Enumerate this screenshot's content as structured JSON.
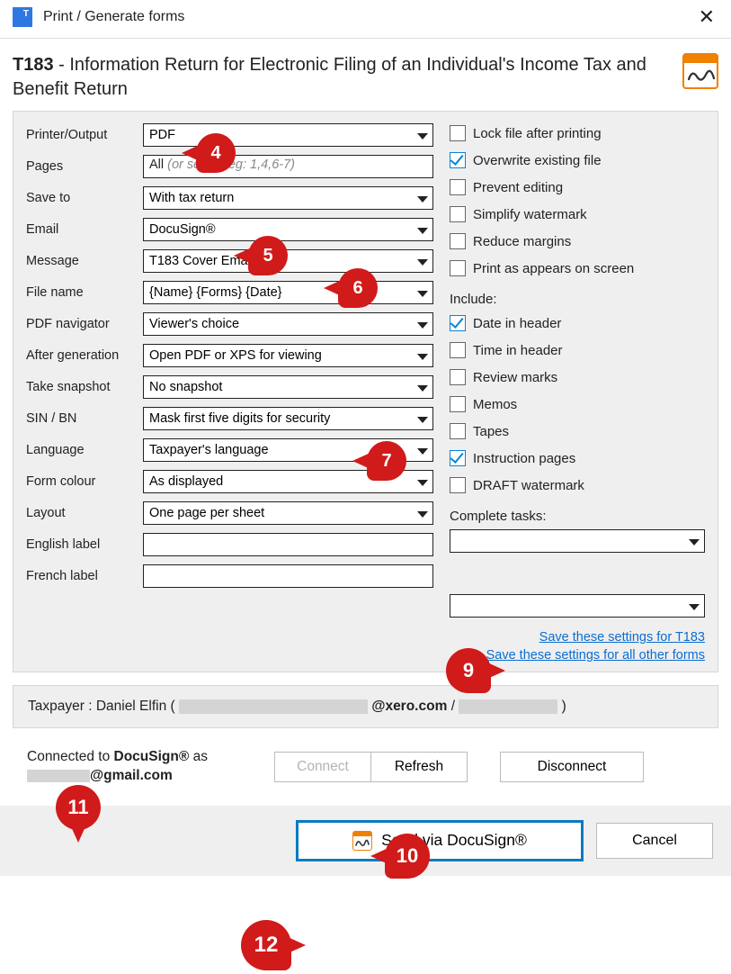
{
  "window": {
    "title": "Print / Generate forms"
  },
  "form": {
    "code": "T183",
    "description": " - Information Return for Electronic Filing of an Individual's Income Tax and Benefit Return"
  },
  "labels": {
    "printer_output": "Printer/Output",
    "pages": "Pages",
    "save_to": "Save to",
    "email": "Email",
    "message": "Message",
    "file_name": "File name",
    "pdf_navigator": "PDF navigator",
    "after_generation": "After generation",
    "take_snapshot": "Take snapshot",
    "sin_bn": "SIN / BN",
    "language": "Language",
    "form_colour": "Form colour",
    "layout": "Layout",
    "english_label": "English label",
    "french_label": "French label",
    "include": "Include:",
    "complete_tasks": "Complete tasks:"
  },
  "values": {
    "printer_output": "PDF",
    "pages_prefix": "All",
    "pages_placeholder": " (or select, eg: 1,4,6-7)",
    "save_to": "With tax return",
    "email": "DocuSign®",
    "message": "T183 Cover Email",
    "file_name": "{Name} {Forms} {Date}",
    "pdf_navigator": "Viewer's choice",
    "after_generation": "Open PDF or XPS for viewing",
    "take_snapshot": "No snapshot",
    "sin_bn": "Mask first five digits for security",
    "language": "Taxpayer's language",
    "form_colour": "As displayed",
    "layout": "One page per sheet",
    "english_label": "",
    "french_label": "",
    "complete_task_1": "",
    "complete_task_2": ""
  },
  "checkboxes_top": [
    {
      "label": "Lock file after printing",
      "checked": false
    },
    {
      "label": "Overwrite existing file",
      "checked": true
    },
    {
      "label": "Prevent editing",
      "checked": false
    },
    {
      "label": "Simplify watermark",
      "checked": false
    },
    {
      "label": "Reduce margins",
      "checked": false
    },
    {
      "label": "Print as appears on screen",
      "checked": false
    }
  ],
  "checkboxes_include": [
    {
      "label": "Date in header",
      "checked": true
    },
    {
      "label": "Time in header",
      "checked": false
    },
    {
      "label": "Review marks",
      "checked": false
    },
    {
      "label": "Memos",
      "checked": false
    },
    {
      "label": "Tapes",
      "checked": false
    },
    {
      "label": "Instruction pages",
      "checked": true
    },
    {
      "label": "DRAFT watermark",
      "checked": false
    }
  ],
  "links": {
    "save_this": "Save these settings for T183",
    "save_all": "Save these settings for all other forms"
  },
  "taxpayer": {
    "prefix": "Taxpayer  :  ",
    "name": "Daniel Elfin",
    "open_paren": " (",
    "email_domain": "@xero.com",
    "separator": " / ",
    "close_paren": ")"
  },
  "docusign": {
    "connected_prefix": "Connected to ",
    "brand": "DocuSign®",
    "connected_suffix": " as",
    "user_suffix": "@gmail.com",
    "btn_connect": "Connect",
    "btn_refresh": "Refresh",
    "btn_disconnect": "Disconnect"
  },
  "footer": {
    "primary": "Send via DocuSign®",
    "cancel": "Cancel"
  },
  "callouts": {
    "c4": "4",
    "c5": "5",
    "c6": "6",
    "c7": "7",
    "c9": "9",
    "c10": "10",
    "c11": "11",
    "c12": "12"
  }
}
